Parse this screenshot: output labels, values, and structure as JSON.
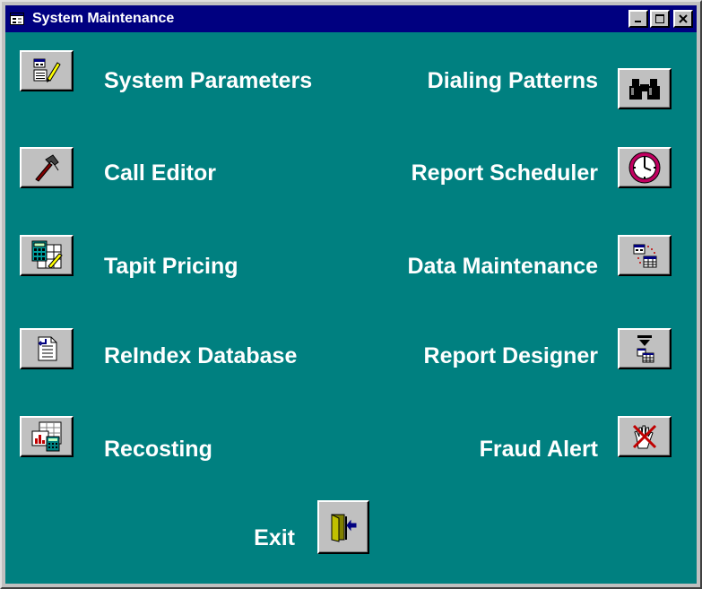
{
  "window": {
    "title": "System Maintenance",
    "controls": [
      "minimize",
      "maximize",
      "close"
    ]
  },
  "left_column": [
    {
      "label": "System Parameters",
      "icon": "form-pencil-icon"
    },
    {
      "label": "Call Editor",
      "icon": "hammer-icon"
    },
    {
      "label": "Tapit Pricing",
      "icon": "calculator-sheet-icon"
    },
    {
      "label": "ReIndex Database",
      "icon": "document-index-icon"
    },
    {
      "label": "Recosting",
      "icon": "chart-calculator-icon"
    }
  ],
  "right_column": [
    {
      "label": "Dialing Patterns",
      "icon": "binoculars-icon"
    },
    {
      "label": "Report Scheduler",
      "icon": "clock-icon"
    },
    {
      "label": "Data Maintenance",
      "icon": "forms-grid-icon"
    },
    {
      "label": "Report Designer",
      "icon": "report-design-icon"
    },
    {
      "label": "Fraud Alert",
      "icon": "hand-stop-icon"
    }
  ],
  "exit": {
    "label": "Exit",
    "icon": "exit-door-icon"
  },
  "colors": {
    "titlebar": "#000080",
    "client_background": "#008080",
    "button_face": "#c0c0c0",
    "label_text": "#ffffff"
  }
}
